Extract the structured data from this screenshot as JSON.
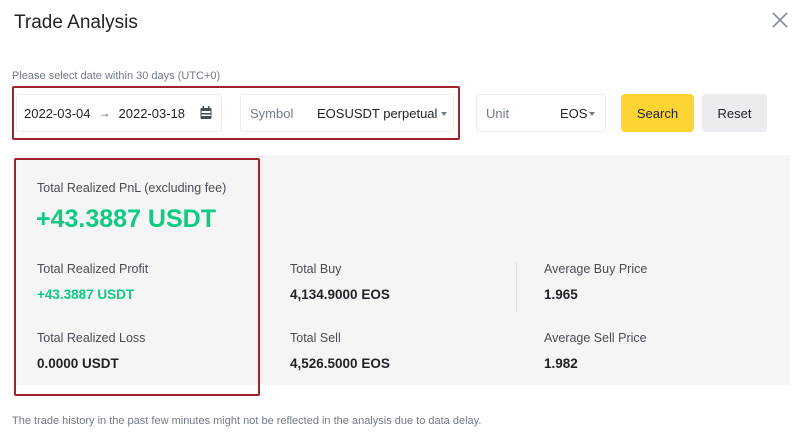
{
  "header": {
    "title": "Trade Analysis"
  },
  "filter": {
    "hint": "Please select date within 30 days (UTC+0)",
    "start_date": "2022-03-04",
    "arrow": "→",
    "end_date": "2022-03-18",
    "symbol_label": "Symbol",
    "symbol_value": "EOSUSDT perpetual",
    "unit_label": "Unit",
    "unit_value": "EOS",
    "search_label": "Search",
    "reset_label": "Reset"
  },
  "summary": {
    "total_pnl_label": "Total Realized PnL (excluding fee)",
    "total_pnl_value": "+43.3887 USDT",
    "profit_label": "Total Realized Profit",
    "profit_value": "+43.3887 USDT",
    "loss_label": "Total Realized Loss",
    "loss_value": "0.0000 USDT",
    "buy_label": "Total Buy",
    "buy_value": "4,134.9000 EOS",
    "sell_label": "Total Sell",
    "sell_value": "4,526.5000 EOS",
    "avg_buy_label": "Average Buy Price",
    "avg_buy_value": "1.965",
    "avg_sell_label": "Average Sell Price",
    "avg_sell_value": "1.982"
  },
  "footer": {
    "note": "The trade history in the past few minutes might not be reflected in the analysis due to data delay."
  },
  "colors": {
    "accent_yellow": "#fcd535",
    "positive_green": "#0ecb81",
    "highlight_red": "#a0242a",
    "panel_bg": "#f5f5f5"
  }
}
